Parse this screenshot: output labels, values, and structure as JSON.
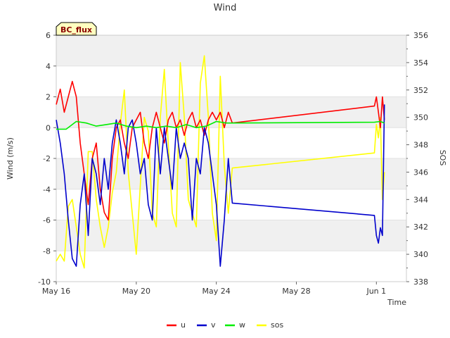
{
  "chart_data": {
    "type": "line",
    "title": "Wind",
    "badge": "BC_flux",
    "xlabel": "Time",
    "ylabel_left": "Wind (m/s)",
    "ylabel_right": "SOS",
    "x_ticks": [
      "May 16",
      "May 20",
      "May 24",
      "May 28",
      "Jun 1"
    ],
    "x_tick_days": [
      0,
      4,
      8,
      12,
      16
    ],
    "x_range_days": [
      0,
      17.5
    ],
    "ylim_left": [
      -10,
      6
    ],
    "y_ticks_left": [
      -10,
      -8,
      -6,
      -4,
      -2,
      0,
      2,
      4,
      6
    ],
    "ylim_right": [
      338,
      356
    ],
    "y_ticks_right": [
      338,
      340,
      342,
      344,
      346,
      348,
      350,
      352,
      354,
      356
    ],
    "grid_bands": true,
    "legend_placement": "bottom",
    "colors": {
      "u": "#ff0000",
      "v": "#0000cc",
      "w": "#00ee00",
      "sos": "#ffff00"
    },
    "series": [
      {
        "name": "u",
        "axis": "left",
        "x": [
          0.0,
          0.2,
          0.4,
          0.6,
          0.8,
          1.0,
          1.2,
          1.4,
          1.6,
          1.8,
          2.0,
          2.2,
          2.4,
          2.6,
          2.8,
          3.0,
          3.2,
          3.4,
          3.6,
          3.8,
          4.0,
          4.2,
          4.4,
          4.6,
          4.8,
          5.0,
          5.2,
          5.4,
          5.6,
          5.8,
          6.0,
          6.2,
          6.4,
          6.6,
          6.8,
          7.0,
          7.2,
          7.4,
          7.6,
          7.8,
          8.0,
          8.2,
          8.4,
          8.6,
          8.8,
          15.9,
          16.0,
          16.1,
          16.2,
          16.3,
          16.4
        ],
        "values": [
          1.5,
          2.5,
          1.0,
          2.0,
          3.0,
          2.0,
          -1.0,
          -3.0,
          -5.0,
          -2.0,
          -1.0,
          -4.0,
          -5.5,
          -6.0,
          -2.0,
          0.0,
          0.5,
          -1.0,
          -2.0,
          0.0,
          0.5,
          1.0,
          -1.0,
          -2.0,
          0.0,
          1.0,
          0.0,
          -1.0,
          0.5,
          1.0,
          0.0,
          0.5,
          -0.5,
          0.5,
          1.0,
          0.0,
          0.5,
          -0.5,
          0.5,
          1.0,
          0.5,
          1.0,
          0.0,
          1.0,
          0.3,
          1.4,
          2.0,
          1.0,
          0.0,
          2.0,
          0.5
        ]
      },
      {
        "name": "v",
        "axis": "left",
        "x": [
          0.0,
          0.2,
          0.4,
          0.6,
          0.8,
          1.0,
          1.2,
          1.4,
          1.6,
          1.8,
          2.0,
          2.2,
          2.4,
          2.6,
          2.8,
          3.0,
          3.2,
          3.4,
          3.6,
          3.8,
          4.0,
          4.2,
          4.4,
          4.6,
          4.8,
          5.0,
          5.2,
          5.4,
          5.6,
          5.8,
          6.0,
          6.2,
          6.4,
          6.6,
          6.8,
          7.0,
          7.2,
          7.4,
          7.6,
          7.8,
          8.0,
          8.2,
          8.4,
          8.6,
          8.8,
          15.9,
          16.0,
          16.1,
          16.2,
          16.3,
          16.4
        ],
        "values": [
          0.5,
          -1.0,
          -3.0,
          -6.0,
          -8.5,
          -9.0,
          -5.0,
          -3.0,
          -7.0,
          -2.0,
          -3.0,
          -5.0,
          -2.0,
          -4.0,
          -1.0,
          0.5,
          -1.0,
          -3.0,
          0.0,
          0.5,
          -1.0,
          -3.0,
          -2.0,
          -5.0,
          -6.0,
          0.0,
          -3.0,
          0.0,
          -2.0,
          -4.0,
          0.0,
          -2.0,
          -1.0,
          -2.0,
          -6.0,
          -2.0,
          -3.0,
          0.0,
          -1.0,
          -3.0,
          -5.0,
          -9.0,
          -6.0,
          -2.0,
          -4.9,
          -5.7,
          -7.0,
          -7.5,
          -6.5,
          -7.0,
          1.5
        ]
      },
      {
        "name": "w",
        "axis": "left",
        "x": [
          0.0,
          0.5,
          1.0,
          1.5,
          2.0,
          2.5,
          3.0,
          3.5,
          4.0,
          4.5,
          5.0,
          5.5,
          6.0,
          6.5,
          7.0,
          7.5,
          8.0,
          8.5,
          8.8,
          15.9,
          16.2,
          16.4
        ],
        "values": [
          -0.1,
          -0.1,
          0.4,
          0.3,
          0.1,
          0.2,
          0.3,
          0.1,
          0.0,
          0.1,
          0.0,
          0.1,
          0.0,
          0.2,
          0.0,
          0.1,
          0.4,
          0.3,
          0.3,
          0.35,
          0.4,
          0.3
        ]
      },
      {
        "name": "sos",
        "axis": "right",
        "x": [
          0.0,
          0.2,
          0.4,
          0.6,
          0.8,
          1.0,
          1.2,
          1.4,
          1.6,
          1.8,
          2.0,
          2.2,
          2.4,
          2.6,
          2.8,
          3.0,
          3.2,
          3.4,
          3.6,
          3.8,
          4.0,
          4.2,
          4.4,
          4.6,
          4.8,
          5.0,
          5.2,
          5.4,
          5.6,
          5.8,
          6.0,
          6.2,
          6.4,
          6.6,
          6.8,
          7.0,
          7.2,
          7.4,
          7.6,
          7.8,
          8.0,
          8.2,
          8.4,
          8.6,
          8.8,
          15.9,
          16.0,
          16.1,
          16.2,
          16.3,
          16.4
        ],
        "values": [
          339.5,
          340.0,
          339.5,
          343.5,
          344.0,
          342.0,
          340.0,
          339.0,
          347.5,
          347.5,
          344.0,
          342.0,
          340.5,
          342.0,
          344.5,
          346.0,
          349.5,
          352.0,
          346.0,
          343.0,
          340.0,
          345.0,
          350.0,
          349.0,
          343.0,
          342.0,
          350.0,
          353.5,
          348.0,
          343.0,
          342.0,
          354.0,
          350.0,
          344.0,
          343.0,
          342.0,
          352.5,
          354.5,
          350.0,
          343.0,
          341.0,
          353.0,
          346.5,
          343.0,
          346.3,
          347.4,
          349.5,
          348.5,
          350.0,
          344.0,
          346.0
        ]
      }
    ]
  }
}
